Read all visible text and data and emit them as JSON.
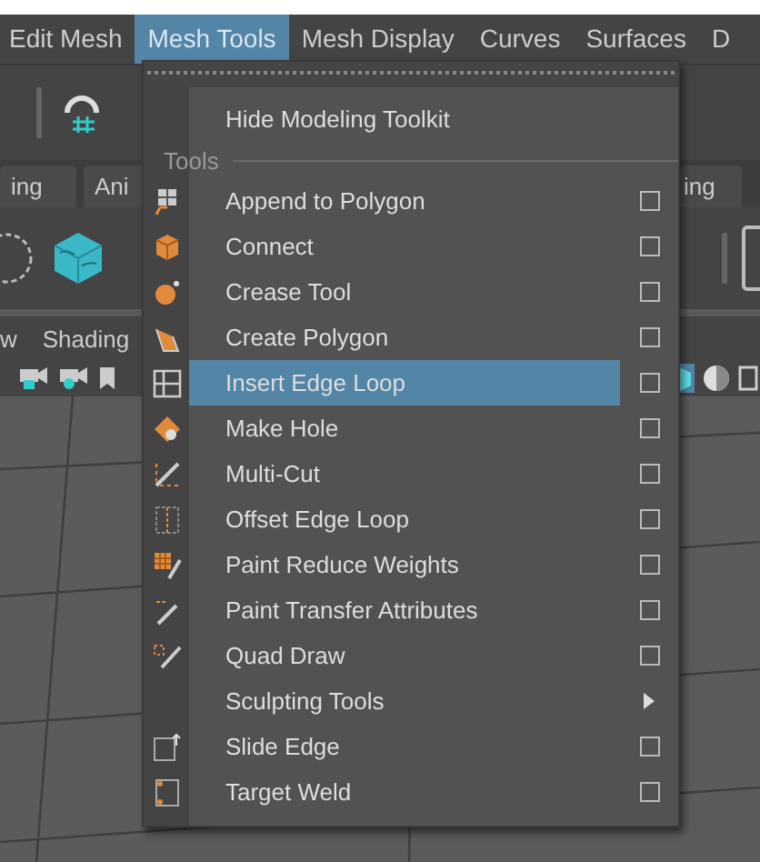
{
  "menubar": [
    {
      "label": "Edit Mesh",
      "selected": false
    },
    {
      "label": "Mesh Tools",
      "selected": true
    },
    {
      "label": "Mesh Display",
      "selected": false
    },
    {
      "label": "Curves",
      "selected": false
    },
    {
      "label": "Surfaces",
      "selected": false
    },
    {
      "label": "D",
      "selected": false
    }
  ],
  "shelf_tabs": [
    {
      "label": "ing"
    },
    {
      "label": "Ani"
    },
    {
      "label": "ing"
    }
  ],
  "panel_menu": [
    "w",
    "Shading"
  ],
  "menu": {
    "items": [
      {
        "kind": "command",
        "label": "Hide Modeling Toolkit"
      },
      {
        "kind": "header",
        "label": "Tools"
      },
      {
        "kind": "option",
        "label": "Append to Polygon",
        "selected": false
      },
      {
        "kind": "option",
        "label": "Connect",
        "selected": false
      },
      {
        "kind": "option",
        "label": "Crease Tool",
        "selected": false
      },
      {
        "kind": "option",
        "label": "Create Polygon",
        "selected": false
      },
      {
        "kind": "option",
        "label": "Insert Edge Loop",
        "selected": true
      },
      {
        "kind": "option",
        "label": "Make Hole",
        "selected": false
      },
      {
        "kind": "option",
        "label": "Multi-Cut",
        "selected": false
      },
      {
        "kind": "option",
        "label": "Offset Edge Loop",
        "selected": false
      },
      {
        "kind": "option",
        "label": "Paint Reduce Weights",
        "selected": false
      },
      {
        "kind": "option",
        "label": "Paint Transfer Attributes",
        "selected": false
      },
      {
        "kind": "option",
        "label": "Quad Draw",
        "selected": false
      },
      {
        "kind": "submenu",
        "label": "Sculpting Tools",
        "selected": false
      },
      {
        "kind": "option",
        "label": "Slide Edge",
        "selected": false
      },
      {
        "kind": "option",
        "label": "Target Weld",
        "selected": false
      }
    ]
  }
}
